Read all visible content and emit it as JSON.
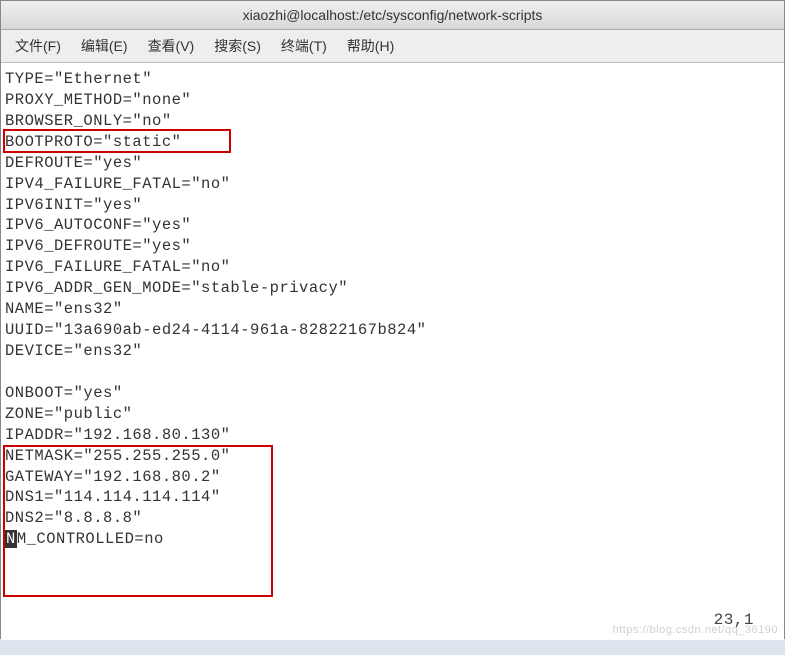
{
  "window": {
    "title": "xiaozhi@localhost:/etc/sysconfig/network-scripts"
  },
  "menubar": {
    "file": "文件(F)",
    "edit": "编辑(E)",
    "view": "查看(V)",
    "search": "搜索(S)",
    "terminal": "终端(T)",
    "help": "帮助(H)"
  },
  "config": {
    "l1": "TYPE=\"Ethernet\"",
    "l2": "PROXY_METHOD=\"none\"",
    "l3": "BROWSER_ONLY=\"no\"",
    "l4": "BOOTPROTO=\"static\"",
    "l5": "DEFROUTE=\"yes\"",
    "l6": "IPV4_FAILURE_FATAL=\"no\"",
    "l7": "IPV6INIT=\"yes\"",
    "l8": "IPV6_AUTOCONF=\"yes\"",
    "l9": "IPV6_DEFROUTE=\"yes\"",
    "l10": "IPV6_FAILURE_FATAL=\"no\"",
    "l11": "IPV6_ADDR_GEN_MODE=\"stable-privacy\"",
    "l12": "NAME=\"ens32\"",
    "l13": "UUID=\"13a690ab-ed24-4114-961a-82822167b824\"",
    "l14": "DEVICE=\"ens32\"",
    "l15": "",
    "l16": "ONBOOT=\"yes\"",
    "l17": "ZONE=\"public\"",
    "l18": "IPADDR=\"192.168.80.130\"",
    "l19": "NETMASK=\"255.255.255.0\"",
    "l20": "GATEWAY=\"192.168.80.2\"",
    "l21": "DNS1=\"114.114.114.114\"",
    "l22": "DNS2=\"8.8.8.8\"",
    "l23_cursor": "N",
    "l23_rest": "M_CONTROLLED=no"
  },
  "status": {
    "position": "23,1"
  },
  "watermark": "https://blog.csdn.net/qq_36190"
}
